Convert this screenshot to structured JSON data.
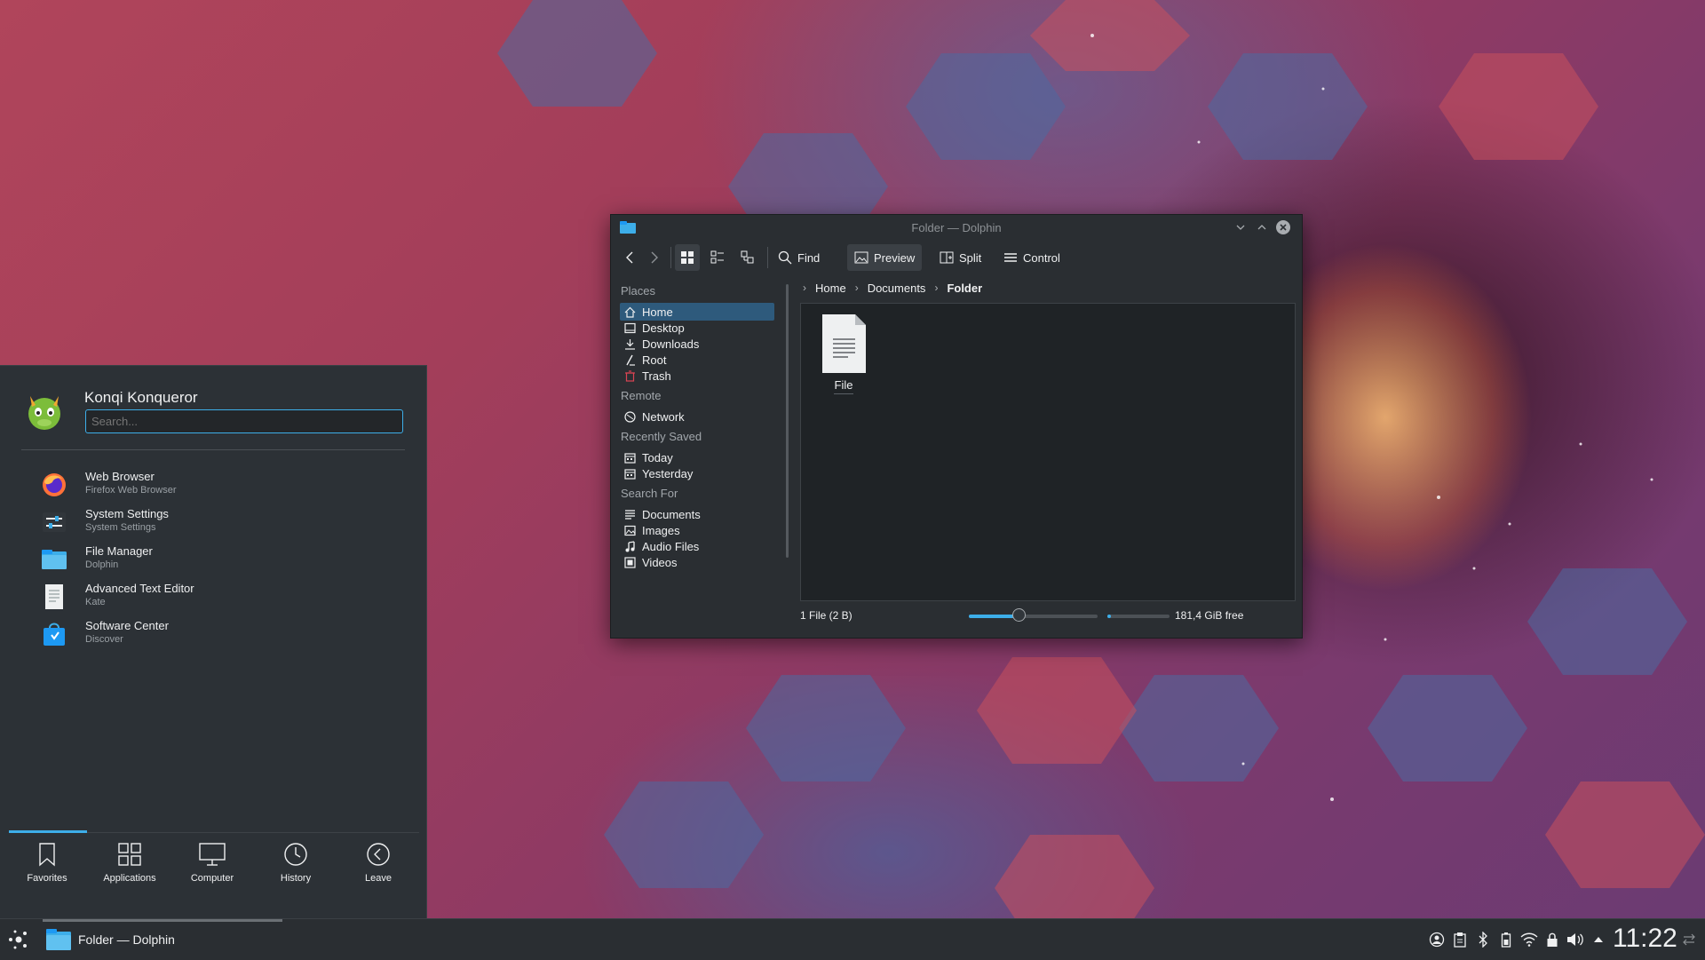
{
  "dolphin": {
    "title": "Folder — Dolphin",
    "toolbar": {
      "find_label": "Find",
      "preview_label": "Preview",
      "split_label": "Split",
      "control_label": "Control"
    },
    "places": {
      "groups": [
        "Places",
        "Remote",
        "Recently Saved",
        "Search For"
      ],
      "items": [
        {
          "label": "Home",
          "icon": "home-icon",
          "selected": true
        },
        {
          "label": "Desktop",
          "icon": "desktop-icon"
        },
        {
          "label": "Downloads",
          "icon": "downloads-icon"
        },
        {
          "label": "Root",
          "icon": "root-icon"
        },
        {
          "label": "Trash",
          "icon": "trash-icon"
        },
        {
          "label": "Network",
          "icon": "network-icon"
        },
        {
          "label": "Today",
          "icon": "calendar-icon"
        },
        {
          "label": "Yesterday",
          "icon": "calendar-icon"
        },
        {
          "label": "Documents",
          "icon": "document-icon"
        },
        {
          "label": "Images",
          "icon": "image-icon"
        },
        {
          "label": "Audio Files",
          "icon": "audio-icon"
        },
        {
          "label": "Videos",
          "icon": "video-icon"
        }
      ]
    },
    "breadcrumb": [
      "Home",
      "Documents",
      "Folder"
    ],
    "files": [
      {
        "name": "File",
        "icon": "text-file-icon"
      }
    ],
    "status": {
      "summary": "1 File (2 B)",
      "zoom_fraction": 0.39,
      "space_used_fraction": 0.05,
      "free_space": "181,4 GiB free"
    }
  },
  "kickoff": {
    "user_name": "Konqi Konqueror",
    "search_placeholder": "Search...",
    "favorites": [
      {
        "name": "Web Browser",
        "desc": "Firefox Web Browser",
        "icon": "firefox-icon"
      },
      {
        "name": "System Settings",
        "desc": "System Settings",
        "icon": "settings-icon"
      },
      {
        "name": "File Manager",
        "desc": "Dolphin",
        "icon": "folder-icon"
      },
      {
        "name": "Advanced Text Editor",
        "desc": "Kate",
        "icon": "text-editor-icon"
      },
      {
        "name": "Software Center",
        "desc": "Discover",
        "icon": "store-icon"
      }
    ],
    "tabs": [
      "Favorites",
      "Applications",
      "Computer",
      "History",
      "Leave"
    ],
    "active_tab": "Favorites"
  },
  "taskbar": {
    "task_label": "Folder — Dolphin",
    "clock": "11:22",
    "tray_icons": [
      "user-icon",
      "clipboard-icon",
      "bluetooth-icon",
      "battery-icon",
      "wifi-icon",
      "lock-icon",
      "volume-icon",
      "expand-arrow-icon"
    ]
  },
  "colors": {
    "accent": "#3daee9",
    "panel_bg": "#2a2e32",
    "selection": "#2e5a7c"
  }
}
